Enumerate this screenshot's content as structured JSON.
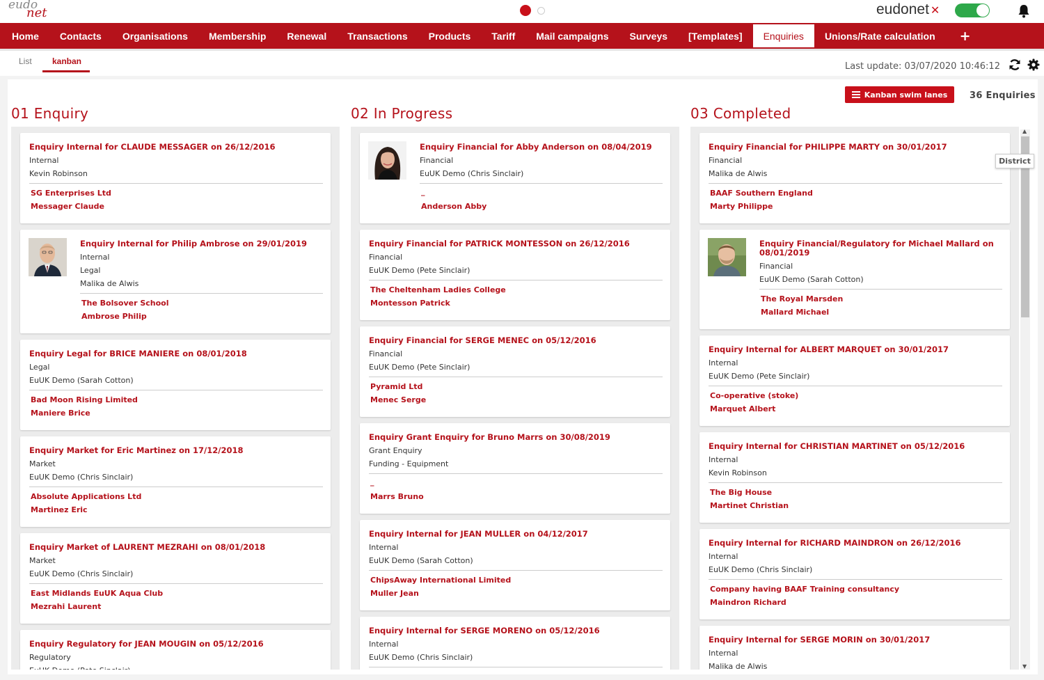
{
  "app": {
    "logo_top": "eudo",
    "logo_bottom": "net",
    "brand": "eudonet",
    "brand_mark": "✕"
  },
  "nav": {
    "items": [
      "Home",
      "Contacts",
      "Organisations",
      "Membership",
      "Renewal",
      "Transactions",
      "Products",
      "Tariff",
      "Mail campaigns",
      "Surveys",
      "[Templates]",
      "Enquiries",
      "Unions/Rate calculation"
    ],
    "active": "Enquiries",
    "plus": "+"
  },
  "subnav": {
    "tabs": [
      "List",
      "kanban"
    ],
    "active": "kanban",
    "last_update": "Last update: 03/07/2020 10:46:12"
  },
  "board": {
    "swim_lanes_button": "Kanban swim lanes",
    "count": "36 Enquiries",
    "tooltip": "District",
    "columns": [
      {
        "title": "01 Enquiry",
        "cards": [
          {
            "title": "Enquiry Internal for CLAUDE MESSAGER on 26/12/2016",
            "lines": [
              "Internal",
              "Kevin Robinson"
            ],
            "links": [
              "SG Enterprises Ltd",
              "Messager Claude"
            ]
          },
          {
            "title": "Enquiry Internal for Philip Ambrose on 29/01/2019",
            "lines": [
              "Internal",
              "Legal",
              "Malika de Alwis"
            ],
            "links": [
              "The Bolsover School",
              "Ambrose Philip"
            ],
            "photo": "man-bald"
          },
          {
            "title": "Enquiry Legal for BRICE MANIERE on 08/01/2018",
            "lines": [
              "Legal",
              "EuUK Demo (Sarah Cotton)"
            ],
            "links": [
              "Bad Moon Rising Limited",
              "Maniere Brice"
            ]
          },
          {
            "title": "Enquiry Market for Eric Martinez on 17/12/2018",
            "lines": [
              "Market",
              "EuUK Demo (Chris Sinclair)"
            ],
            "links": [
              "Absolute Applications Ltd",
              "Martinez Eric"
            ]
          },
          {
            "title": "Enquiry Market of LAURENT MEZRAHI on 08/01/2018",
            "lines": [
              "Market",
              "EuUK Demo (Chris Sinclair)"
            ],
            "links": [
              "East Midlands EuUK Aqua Club",
              "Mezrahi Laurent"
            ]
          },
          {
            "title": "Enquiry Regulatory for JEAN MOUGIN on 05/12/2016",
            "lines": [
              "Regulatory",
              "EuUK Demo (Pete Sinclair)"
            ],
            "links": []
          }
        ]
      },
      {
        "title": "02 In Progress",
        "cards": [
          {
            "title": "Enquiry Financial for Abby Anderson on 08/04/2019",
            "lines": [
              "Financial",
              "EuUK Demo (Chris Sinclair)"
            ],
            "dash": "_",
            "links": [
              "Anderson Abby"
            ],
            "photo": "woman"
          },
          {
            "title": "Enquiry Financial for PATRICK MONTESSON on 26/12/2016",
            "lines": [
              "Financial",
              "EuUK Demo (Pete Sinclair)"
            ],
            "links": [
              "The Cheltenham Ladies College",
              "Montesson Patrick"
            ]
          },
          {
            "title": "Enquiry Financial for SERGE MENEC on 05/12/2016",
            "lines": [
              "Financial",
              "EuUK Demo (Pete Sinclair)"
            ],
            "links": [
              "Pyramid Ltd",
              "Menec Serge"
            ]
          },
          {
            "title": "Enquiry Grant Enquiry for Bruno Marrs on 30/08/2019",
            "lines": [
              "Grant Enquiry",
              "Funding - Equipment"
            ],
            "dash": "_",
            "links": [
              "Marrs Bruno"
            ]
          },
          {
            "title": "Enquiry Internal for JEAN MULLER on 04/12/2017",
            "lines": [
              "Internal",
              "EuUK Demo (Sarah Cotton)"
            ],
            "links": [
              "ChipsAway International Limited",
              "Muller Jean"
            ]
          },
          {
            "title": "Enquiry Internal for SERGE MORENO on 05/12/2016",
            "lines": [
              "Internal",
              "EuUK Demo (Chris Sinclair)"
            ],
            "links": []
          }
        ]
      },
      {
        "title": "03 Completed",
        "cards": [
          {
            "title": "Enquiry Financial for PHILIPPE MARTY on 30/01/2017",
            "lines": [
              "Financial",
              "Malika de Alwis"
            ],
            "links": [
              "BAAF Southern England",
              "Marty Philippe"
            ]
          },
          {
            "title": "Enquiry Financial/Regulatory for Michael Mallard on 08/01/2019",
            "lines": [
              "Financial",
              "EuUK Demo (Sarah Cotton)"
            ],
            "links": [
              "The Royal Marsden",
              "Mallard Michael"
            ],
            "photo": "man-beard"
          },
          {
            "title": "Enquiry Internal for ALBERT MARQUET on 30/01/2017",
            "lines": [
              "Internal",
              "EuUK Demo (Pete Sinclair)"
            ],
            "links": [
              "Co-operative (stoke)",
              "Marquet Albert"
            ]
          },
          {
            "title": "Enquiry Internal for CHRISTIAN MARTINET on 05/12/2016",
            "lines": [
              "Internal",
              "Kevin Robinson"
            ],
            "links": [
              "The Big House",
              "Martinet Christian"
            ]
          },
          {
            "title": "Enquiry Internal for RICHARD MAINDRON on 26/12/2016",
            "lines": [
              "Internal",
              "EuUK Demo (Chris Sinclair)"
            ],
            "links": [
              "Company having BAAF Training consultancy",
              "Maindron Richard"
            ]
          },
          {
            "title": "Enquiry Internal for SERGE MORIN on 30/01/2017",
            "lines": [
              "Internal",
              "Malika de Alwis"
            ],
            "links": []
          }
        ]
      }
    ]
  },
  "colors": {
    "brand_red": "#b5121b",
    "toggle_green": "#2ea84a"
  }
}
